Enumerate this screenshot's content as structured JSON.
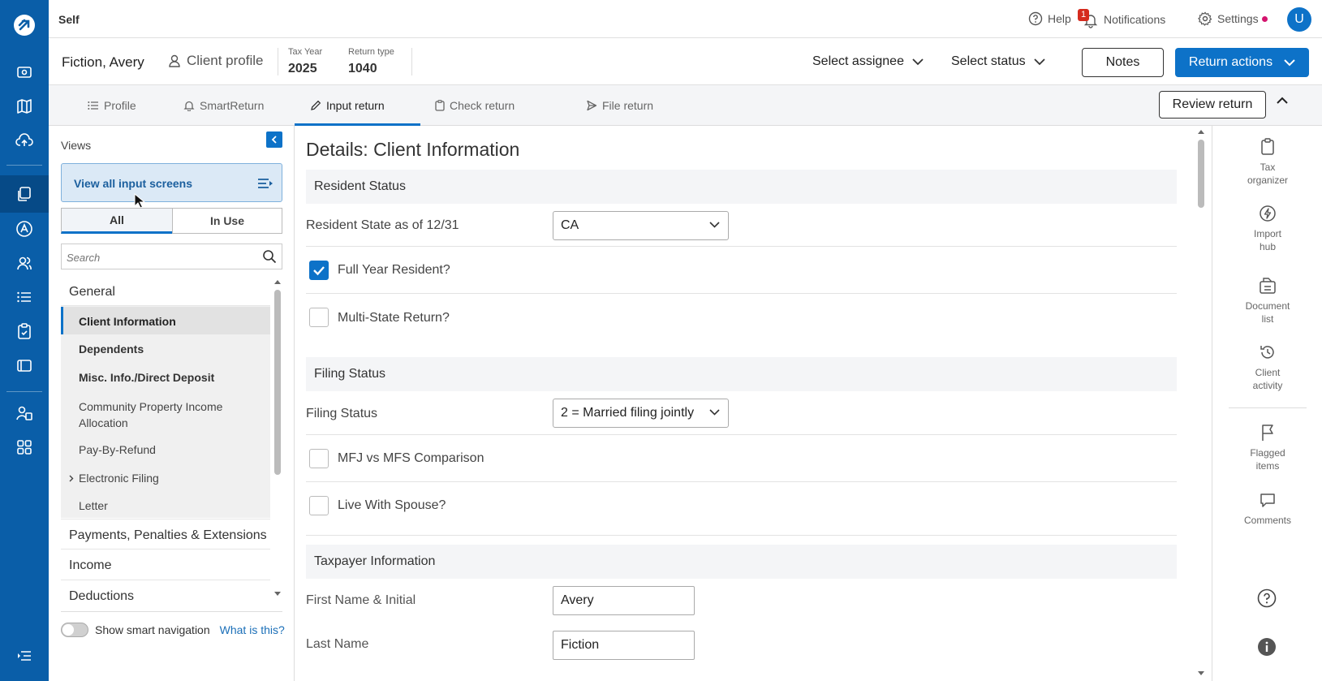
{
  "topbar": {
    "workspace": "Self",
    "help": "Help",
    "notifications": "Notifications",
    "notification_count": "1",
    "settings": "Settings",
    "avatar_initial": "U"
  },
  "client": {
    "name": "Fiction, Avery",
    "profile_label": "Client profile",
    "tax_year_label": "Tax Year",
    "tax_year": "2025",
    "return_type_label": "Return type",
    "return_type": "1040",
    "assignee": "Select assignee",
    "status": "Select status",
    "notes_label": "Notes",
    "actions_label": "Return actions"
  },
  "tabs": [
    {
      "label": "Profile",
      "icon": "list-icon"
    },
    {
      "label": "SmartReturn",
      "icon": "bell-icon"
    },
    {
      "label": "Input return",
      "icon": "pencil-icon"
    },
    {
      "label": "Check return",
      "icon": "clipboard-icon"
    },
    {
      "label": "File return",
      "icon": "send-icon"
    }
  ],
  "review_label": "Review return",
  "views": {
    "title": "Views",
    "view_all_label": "View all input screens",
    "segments": [
      "All",
      "In Use"
    ],
    "search_placeholder": "Search",
    "sections": {
      "general": "General",
      "payments": "Payments, Penalties & Extensions",
      "income": "Income",
      "deductions": "Deductions"
    },
    "items": [
      "Client Information",
      "Dependents",
      "Misc. Info./Direct Deposit",
      "Community Property Income Allocation",
      "Pay-By-Refund",
      "Electronic Filing",
      "Letter"
    ],
    "smart_nav_label": "Show smart navigation",
    "what_is_this": "What is this?"
  },
  "form": {
    "title": "Details: Client Information",
    "resident_status": {
      "heading": "Resident Status",
      "state_label": "Resident State as of 12/31",
      "state_value": "CA",
      "full_year_label": "Full Year Resident?",
      "full_year_checked": true,
      "multi_state_label": "Multi-State Return?",
      "multi_state_checked": false
    },
    "filing_status": {
      "heading": "Filing Status",
      "label": "Filing Status",
      "value": "2 = Married filing jointly",
      "mfj_label": "MFJ vs MFS Comparison",
      "live_label": "Live With Spouse?"
    },
    "taxpayer": {
      "heading": "Taxpayer Information",
      "first_label": "First Name & Initial",
      "first_value": "Avery",
      "last_label": "Last Name",
      "last_value": "Fiction"
    }
  },
  "right_rail": [
    {
      "label1": "Tax",
      "label2": "organizer",
      "icon": "clipboard-icon"
    },
    {
      "label1": "Import",
      "label2": "hub",
      "icon": "lightning-icon"
    },
    {
      "label1": "Document",
      "label2": "list",
      "icon": "document-list-icon"
    },
    {
      "label1": "Client",
      "label2": "activity",
      "icon": "history-icon"
    },
    {
      "label1": "Flagged",
      "label2": "items",
      "icon": "flag-icon"
    },
    {
      "label1": "Comments",
      "label2": "",
      "icon": "comment-icon"
    }
  ],
  "colors": {
    "rail": "#0a5ea8",
    "accent": "#0d72c8",
    "notification_badge": "#d52b1e",
    "settings_dot": "#d4146e"
  }
}
